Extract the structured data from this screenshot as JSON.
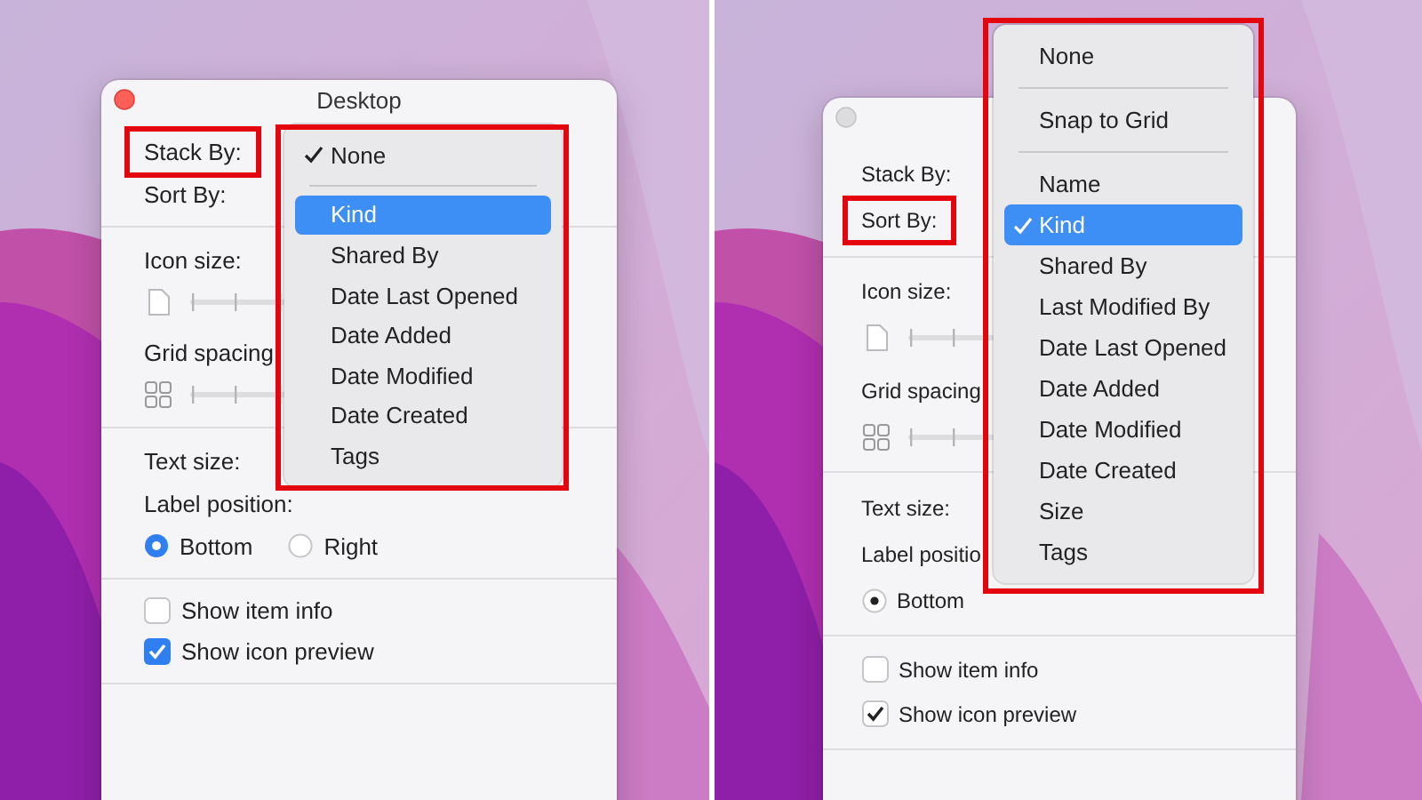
{
  "panels": [
    {
      "window": {
        "title": "Desktop",
        "close_active": true
      },
      "fields": [
        {
          "label": "Stack By:",
          "highlighted": true
        },
        {
          "label": "Sort By:",
          "highlighted": false
        }
      ],
      "icon_size": {
        "label": "Icon size:"
      },
      "grid_spacing": {
        "label": "Grid spacing"
      },
      "text_size": {
        "label": "Text size:"
      },
      "label_position": {
        "label": "Label position:",
        "options": [
          {
            "label": "Bottom",
            "selected": true
          },
          {
            "label": "Right",
            "selected": false
          }
        ]
      },
      "checkboxes": [
        {
          "label": "Show item info",
          "checked": false
        },
        {
          "label": "Show icon preview",
          "checked": true
        }
      ],
      "menu": {
        "highlighted": true,
        "items": [
          {
            "kind": "item",
            "label": "None",
            "checked": true,
            "hovered": false
          },
          {
            "kind": "separator"
          },
          {
            "kind": "item",
            "label": "Kind",
            "checked": false,
            "hovered": true
          },
          {
            "kind": "item",
            "label": "Shared By",
            "checked": false,
            "hovered": false
          },
          {
            "kind": "item",
            "label": "Date Last Opened",
            "checked": false,
            "hovered": false
          },
          {
            "kind": "item",
            "label": "Date Added",
            "checked": false,
            "hovered": false
          },
          {
            "kind": "item",
            "label": "Date Modified",
            "checked": false,
            "hovered": false
          },
          {
            "kind": "item",
            "label": "Date Created",
            "checked": false,
            "hovered": false
          },
          {
            "kind": "item",
            "label": "Tags",
            "checked": false,
            "hovered": false
          }
        ]
      }
    },
    {
      "window": {
        "close_active": false
      },
      "fields": [
        {
          "label": "Stack By:",
          "highlighted": false
        },
        {
          "label": "Sort By:",
          "highlighted": true
        }
      ],
      "icon_size": {
        "label": "Icon size:"
      },
      "grid_spacing": {
        "label": "Grid spacing"
      },
      "text_size": {
        "label": "Text size:"
      },
      "label_position": {
        "label": "Label positio",
        "options": [
          {
            "label": "Bottom",
            "selected": true
          }
        ]
      },
      "checkboxes": [
        {
          "label": "Show item info",
          "checked": false
        },
        {
          "label": "Show icon preview",
          "checked": true
        }
      ],
      "menu": {
        "highlighted": true,
        "items": [
          {
            "kind": "item",
            "label": "None",
            "checked": false,
            "hovered": false
          },
          {
            "kind": "separator"
          },
          {
            "kind": "item",
            "label": "Snap to Grid",
            "checked": false,
            "hovered": false
          },
          {
            "kind": "separator"
          },
          {
            "kind": "item",
            "label": "Name",
            "checked": false,
            "hovered": false
          },
          {
            "kind": "item",
            "label": "Kind",
            "checked": true,
            "hovered": true
          },
          {
            "kind": "item",
            "label": "Shared By",
            "checked": false,
            "hovered": false
          },
          {
            "kind": "item",
            "label": "Last Modified By",
            "checked": false,
            "hovered": false
          },
          {
            "kind": "item",
            "label": "Date Last Opened",
            "checked": false,
            "hovered": false
          },
          {
            "kind": "item",
            "label": "Date Added",
            "checked": false,
            "hovered": false
          },
          {
            "kind": "item",
            "label": "Date Modified",
            "checked": false,
            "hovered": false
          },
          {
            "kind": "item",
            "label": "Date Created",
            "checked": false,
            "hovered": false
          },
          {
            "kind": "item",
            "label": "Size",
            "checked": false,
            "hovered": false
          },
          {
            "kind": "item",
            "label": "Tags",
            "checked": false,
            "hovered": false
          }
        ]
      }
    }
  ]
}
